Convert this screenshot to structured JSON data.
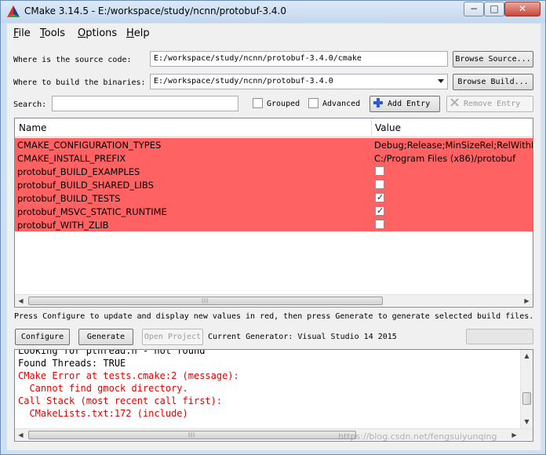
{
  "window": {
    "title": "CMake 3.14.5 - E:/workspace/study/ncnn/protobuf-3.4.0",
    "min_glyph": "−",
    "max_glyph": "□",
    "close_glyph": "✕"
  },
  "menu": {
    "items": [
      {
        "mnemonic": "F",
        "rest": "ile"
      },
      {
        "mnemonic": "T",
        "rest": "ools"
      },
      {
        "mnemonic": "O",
        "rest": "ptions"
      },
      {
        "mnemonic": "H",
        "rest": "elp"
      }
    ]
  },
  "paths": {
    "source_label": "Where is the source code:",
    "source_value": "E:/workspace/study/ncnn/protobuf-3.4.0/cmake",
    "browse_source_label": "Browse Source...",
    "build_label": "Where to build the binaries:",
    "build_value": "E:/workspace/study/ncnn/protobuf-3.4.0",
    "browse_build_label": "Browse Build..."
  },
  "search": {
    "label": "Search:",
    "value": "",
    "grouped_label": "Grouped",
    "grouped_checked": false,
    "advanced_label": "Advanced",
    "advanced_checked": false,
    "add_entry_label": "Add Entry",
    "remove_entry_label": "Remove Entry"
  },
  "table": {
    "columns": [
      "Name",
      "Value"
    ],
    "highlight_color": "#ff6262",
    "rows": [
      {
        "name": "CMAKE_CONFIGURATION_TYPES",
        "type": "text",
        "value": "Debug;Release;MinSizeRel;RelWithDebInfo"
      },
      {
        "name": "CMAKE_INSTALL_PREFIX",
        "type": "text",
        "value": "C:/Program Files (x86)/protobuf"
      },
      {
        "name": "protobuf_BUILD_EXAMPLES",
        "type": "bool",
        "checked": false
      },
      {
        "name": "protobuf_BUILD_SHARED_LIBS",
        "type": "bool",
        "checked": false
      },
      {
        "name": "protobuf_BUILD_TESTS",
        "type": "bool",
        "checked": true
      },
      {
        "name": "protobuf_MSVC_STATIC_RUNTIME",
        "type": "bool",
        "checked": true
      },
      {
        "name": "protobuf_WITH_ZLIB",
        "type": "bool",
        "checked": false
      }
    ]
  },
  "hint": "Press Configure to update and display new values in red, then press Generate to generate selected build files.",
  "actions": {
    "configure_label": "Configure",
    "generate_label": "Generate",
    "open_project_label": "Open Project",
    "generator_label": "Current Generator: Visual Studio 14 2015"
  },
  "progress": {
    "value": 0
  },
  "output": {
    "lines": [
      {
        "text": "Looking for pthread.h - not found",
        "error": false
      },
      {
        "text": "Found Threads: TRUE",
        "error": false
      },
      {
        "text": "CMake Error at tests.cmake:2 (message):",
        "error": true
      },
      {
        "text": "  Cannot find gmock directory.",
        "error": true
      },
      {
        "text": "Call Stack (most recent call first):",
        "error": true
      },
      {
        "text": "  CMakeLists.txt:172 (include)",
        "error": true
      }
    ]
  },
  "watermark": "https://blog.csdn.net/fengsuiyunqing",
  "icons": {
    "logo": "cmake-logo-icon",
    "add": "plus-icon",
    "remove": "x-icon"
  }
}
